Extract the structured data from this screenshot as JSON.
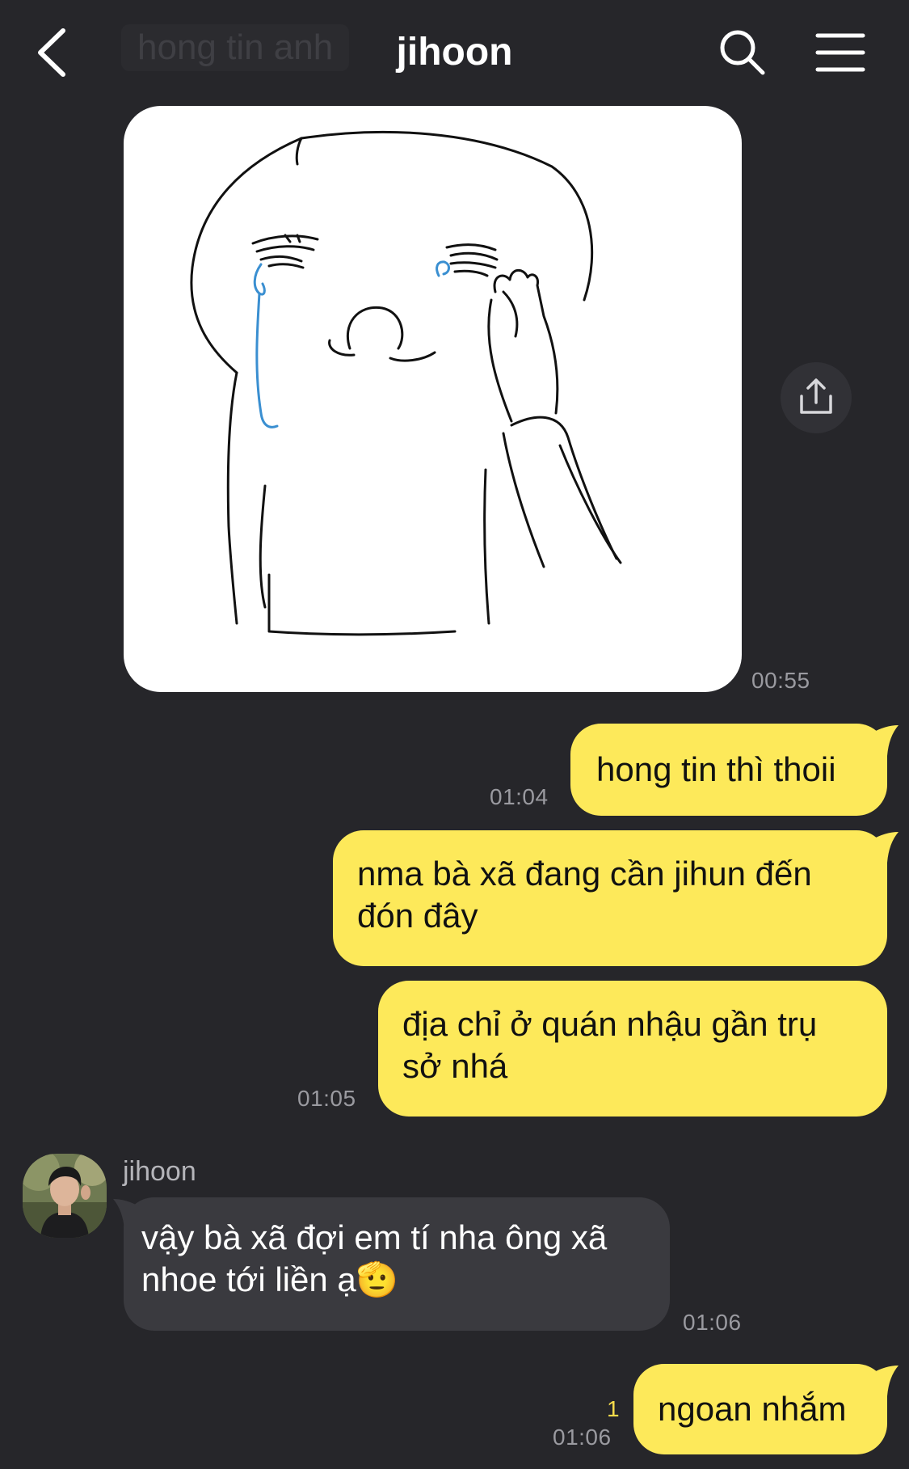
{
  "header": {
    "title": "jihoon",
    "ghost_text": "hong tin anh"
  },
  "messages": [
    {
      "kind": "image",
      "sender": "other",
      "time": "00:55",
      "description": "sticker-crying-face-drawing"
    },
    {
      "kind": "text",
      "sender": "me",
      "text": "hong tin thì thoii",
      "time": "01:04"
    },
    {
      "kind": "text",
      "sender": "me",
      "text_lines": [
        "nma bà xã đang cần jihun đến",
        "đón đây"
      ]
    },
    {
      "kind": "text",
      "sender": "me",
      "text_lines": [
        "địa chỉ ở quán nhậu gần trụ",
        "sở nhá"
      ],
      "time": "01:05"
    },
    {
      "kind": "text",
      "sender": "other",
      "sender_name": "jihoon",
      "text_lines": [
        "vậy bà xã đợi em tí nha ông xã",
        "nhoe tới liền ạ"
      ],
      "emoji": "🫡",
      "time": "01:06"
    },
    {
      "kind": "text",
      "sender": "me",
      "text": "ngoan nhắm",
      "time": "01:06",
      "unread_count": "1"
    }
  ],
  "colors": {
    "background": "#26262a",
    "my_bubble": "#fde95a",
    "their_bubble": "#3a3a3f",
    "unread": "#f6dc4b"
  },
  "icons": [
    "back-icon",
    "search-icon",
    "menu-icon",
    "share-icon"
  ]
}
